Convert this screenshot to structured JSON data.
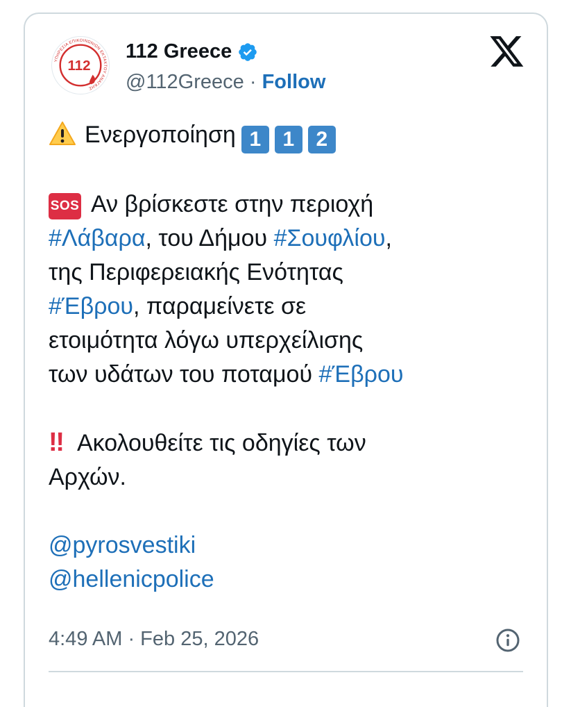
{
  "account": {
    "display_name": "112 Greece",
    "handle": "@112Greece",
    "separator": "·",
    "follow_label": "Follow",
    "avatar_text": "112",
    "avatar_ring_text": "ΥΠΗΡΕΣΙΑ ΕΠΙΚΟΙΝΩΝΙΩΝ ΕΚΤΑΚΤΟΥ ΑΝΑΓΚΗΣ",
    "verified_color": "#1d9bf0",
    "verified_icon": "verified-badge-icon"
  },
  "platform_icon": "x-logo-icon",
  "tweet": {
    "line1_text": "Ενεργοποίηση",
    "keycaps": [
      "1",
      "1",
      "2"
    ],
    "sos_label": "SOS",
    "p2_text1": "Αν βρίσκεστε στην περιοχή",
    "p2_tag1": "#Λάβαρα",
    "p2_text2": ", του Δήμου",
    "p2_tag2": "#Σουφλίου",
    "p2_text3": ",",
    "p2_text4": "της Περιφερειακής Ενότητας",
    "p2_tag3": "#Έβρου",
    "p2_text5": ", παραμείνετε σε",
    "p2_text6": "ετοιμότητα λόγω υπερχείλισης",
    "p2_text7": "των υδάτων του ποταμού",
    "p2_tag4": "#Έβρου",
    "bangbang": "‼",
    "p3_text1": "Ακολουθείτε τις οδηγίες των",
    "p3_text2": "Αρχών.",
    "mention1": "@pyrosvestiki",
    "mention2": "@hellenicpolice"
  },
  "timestamp": "4:49 AM · Feb 25, 2026",
  "colors": {
    "link": "#1d6fb8",
    "keycap": "#3d87c9",
    "sos": "#dd2e44",
    "secondary_text": "#536471",
    "border": "#cfd9de"
  }
}
